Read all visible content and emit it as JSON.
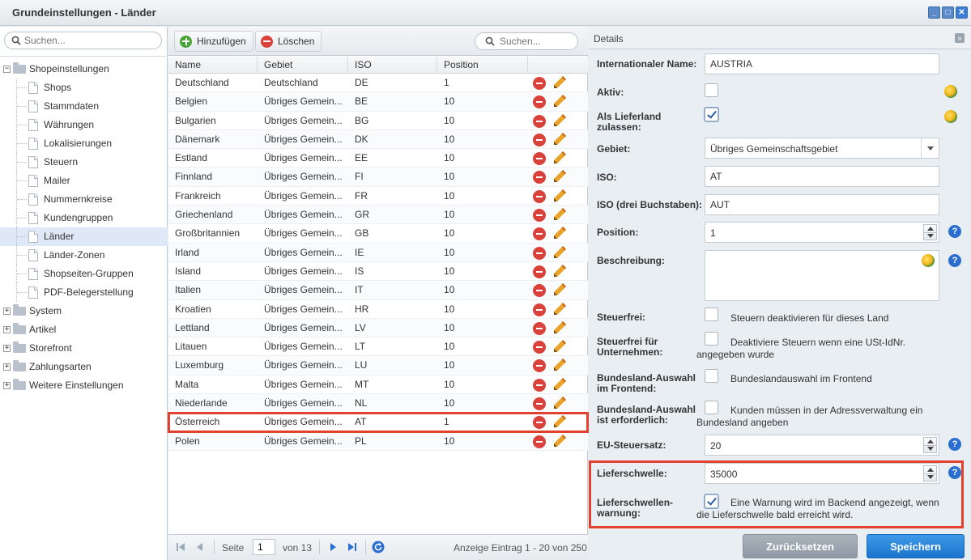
{
  "window": {
    "title": "Grundeinstellungen - Länder"
  },
  "tree": {
    "search_placeholder": "Suchen...",
    "items": [
      {
        "label": "Shopeinstellungen",
        "type": "root",
        "expanded": true
      },
      {
        "label": "Shops",
        "type": "child"
      },
      {
        "label": "Stammdaten",
        "type": "child"
      },
      {
        "label": "Währungen",
        "type": "child"
      },
      {
        "label": "Lokalisierungen",
        "type": "child"
      },
      {
        "label": "Steuern",
        "type": "child"
      },
      {
        "label": "Mailer",
        "type": "child"
      },
      {
        "label": "Nummernkreise",
        "type": "child"
      },
      {
        "label": "Kundengruppen",
        "type": "child"
      },
      {
        "label": "Länder",
        "type": "child",
        "selected": true
      },
      {
        "label": "Länder-Zonen",
        "type": "child"
      },
      {
        "label": "Shopseiten-Gruppen",
        "type": "child"
      },
      {
        "label": "PDF-Belegerstellung",
        "type": "child"
      },
      {
        "label": "System",
        "type": "root"
      },
      {
        "label": "Artikel",
        "type": "root"
      },
      {
        "label": "Storefront",
        "type": "root"
      },
      {
        "label": "Zahlungsarten",
        "type": "root"
      },
      {
        "label": "Weitere Einstellungen",
        "type": "root"
      }
    ]
  },
  "toolbar": {
    "add_label": "Hinzufügen",
    "delete_label": "Löschen",
    "search_placeholder": "Suchen..."
  },
  "grid": {
    "columns": [
      "Name",
      "Gebiet",
      "ISO",
      "Position"
    ],
    "rows": [
      [
        "Deutschland",
        "Deutschland",
        "DE",
        "1"
      ],
      [
        "Belgien",
        "Übriges Gemein...",
        "BE",
        "10"
      ],
      [
        "Bulgarien",
        "Übriges Gemein...",
        "BG",
        "10"
      ],
      [
        "Dänemark",
        "Übriges Gemein...",
        "DK",
        "10"
      ],
      [
        "Estland",
        "Übriges Gemein...",
        "EE",
        "10"
      ],
      [
        "Finnland",
        "Übriges Gemein...",
        "FI",
        "10"
      ],
      [
        "Frankreich",
        "Übriges Gemein...",
        "FR",
        "10"
      ],
      [
        "Griechenland",
        "Übriges Gemein...",
        "GR",
        "10"
      ],
      [
        "Großbritannien",
        "Übriges Gemein...",
        "GB",
        "10"
      ],
      [
        "Irland",
        "Übriges Gemein...",
        "IE",
        "10"
      ],
      [
        "Island",
        "Übriges Gemein...",
        "IS",
        "10"
      ],
      [
        "Italien",
        "Übriges Gemein...",
        "IT",
        "10"
      ],
      [
        "Kroatien",
        "Übriges Gemein...",
        "HR",
        "10"
      ],
      [
        "Lettland",
        "Übriges Gemein...",
        "LV",
        "10"
      ],
      [
        "Litauen",
        "Übriges Gemein...",
        "LT",
        "10"
      ],
      [
        "Luxemburg",
        "Übriges Gemein...",
        "LU",
        "10"
      ],
      [
        "Malta",
        "Übriges Gemein...",
        "MT",
        "10"
      ],
      [
        "Niederlande",
        "Übriges Gemein...",
        "NL",
        "10"
      ],
      [
        "Österreich",
        "Übriges Gemein...",
        "AT",
        "1"
      ],
      [
        "Polen",
        "Übriges Gemein...",
        "PL",
        "10"
      ]
    ],
    "highlighted_row": 18
  },
  "pager": {
    "page_label": "Seite",
    "page_value": "1",
    "of_label": "von 13",
    "display_text": "Anzeige Eintrag 1 - 20 von 250"
  },
  "detail": {
    "title": "Details",
    "collapse_icon": "»",
    "fields": {
      "intl_name_label": "Internationaler Name:",
      "intl_name_value": "AUSTRIA",
      "active_label": "Aktiv:",
      "delivery_label": "Als Lieferland zulassen:",
      "region_label": "Gebiet:",
      "region_value": "Übriges Gemeinschaftsgebiet",
      "iso_label": "ISO:",
      "iso_value": "AT",
      "iso3_label": "ISO (drei Buchstaben):",
      "iso3_value": "AUT",
      "position_label": "Position:",
      "position_value": "1",
      "description_label": "Beschreibung:",
      "taxfree_label": "Steuerfrei:",
      "taxfree_text": "Steuern deaktivieren für dieses Land",
      "taxfree_company_label": "Steuerfrei für Unternehmen:",
      "taxfree_company_text": "Deaktiviere Steuern wenn eine USt-IdNr. angegeben wurde",
      "state_select_label": "Bundesland-Auswahl im Frontend:",
      "state_select_text": "Bundeslandauswahl im Frontend",
      "state_required_label": "Bundesland-Auswahl ist erforderlich:",
      "state_required_text": "Kunden müssen in der Adressverwaltung ein Bundesland angeben",
      "eu_tax_label": "EU-Steuersatz:",
      "eu_tax_value": "20",
      "threshold_label": "Lieferschwelle:",
      "threshold_value": "35000",
      "threshold_warning_label": "Lieferschwellen-warnung:",
      "threshold_warning_text": "Eine Warnung wird im Backend angezeigt, wenn die Lieferschwelle bald erreicht wird."
    },
    "help_glyph": "?",
    "reset_label": "Zurücksetzen",
    "save_label": "Speichern"
  },
  "colors": {
    "accent": "#1b74cc",
    "highlight_box": "#e2412f",
    "add_green": "#4aa537",
    "delete_red": "#d9413b",
    "edit_orange": "#e9a22a"
  }
}
